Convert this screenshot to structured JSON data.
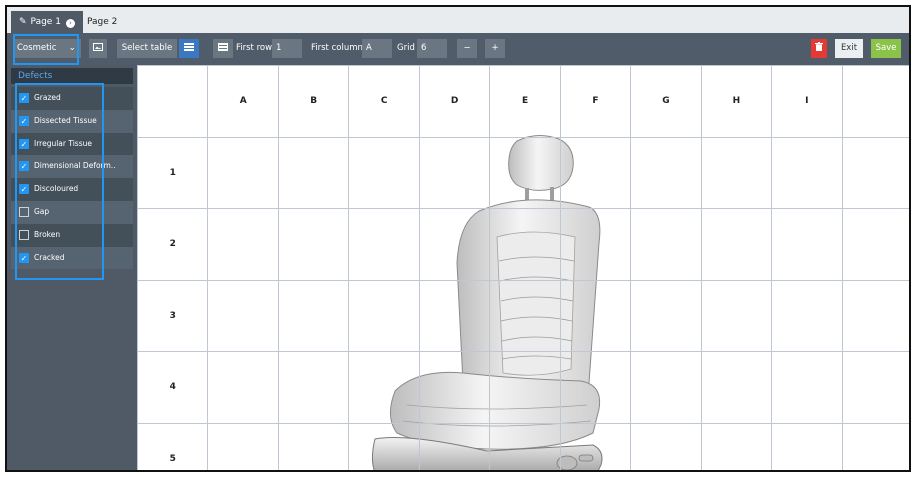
{
  "tabs": [
    {
      "label": "Page 1",
      "active": true
    },
    {
      "label": "Page 2",
      "active": false
    }
  ],
  "toolbar": {
    "category_select": "Cosmetic",
    "select_table_label": "Select table",
    "first_row_label": "First row",
    "first_row_value": "1",
    "first_column_label": "First column",
    "first_column_value": "A",
    "grid_label": "Grid",
    "grid_value": "6",
    "minus_label": "−",
    "plus_label": "+",
    "exit_label": "Exit",
    "save_label": "Save"
  },
  "sidebar": {
    "header": "Defects",
    "defects": [
      {
        "label": "Grazed",
        "checked": true
      },
      {
        "label": "Dissected Tissue",
        "checked": true
      },
      {
        "label": "Irregular Tissue",
        "checked": true
      },
      {
        "label": "Dimensional Deform..",
        "checked": true
      },
      {
        "label": "Discoloured",
        "checked": true
      },
      {
        "label": "Gap",
        "checked": false
      },
      {
        "label": "Broken",
        "checked": false
      },
      {
        "label": "Cracked",
        "checked": true
      }
    ]
  },
  "grid": {
    "columns": [
      "A",
      "B",
      "C",
      "D",
      "E",
      "F",
      "G",
      "H",
      "I"
    ],
    "rows": [
      "1",
      "2",
      "3",
      "4",
      "5"
    ]
  },
  "colors": {
    "accent": "#2196f3",
    "toolbar": "#505c69",
    "sidebar": "#4f5a66",
    "delete": "#e53935",
    "save": "#8bc34a"
  }
}
